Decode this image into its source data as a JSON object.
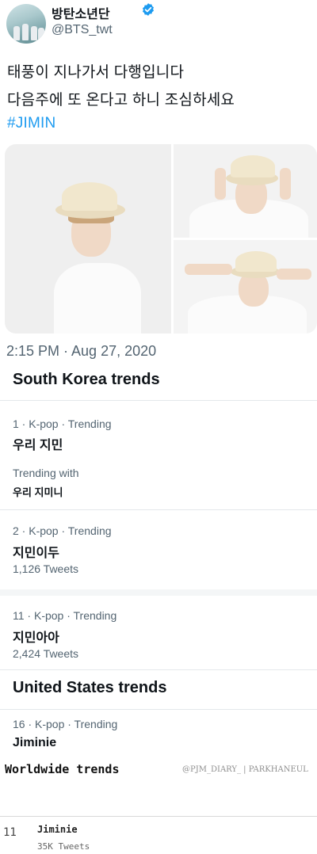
{
  "tweet": {
    "author_name": "방탄소년단",
    "author_handle": "@BTS_twt",
    "text_line1": "태풍이 지나가서 다행입니다",
    "text_line2": "다음주에 또 온다고 하니 조심하세요",
    "hashtag": "#JIMIN",
    "timestamp": "2:15 PM · Aug 27, 2020",
    "verified_icon": "verified-badge-icon",
    "accent_color": "#1d9bf0"
  },
  "south_korea": {
    "title": "South Korea trends",
    "trends": [
      {
        "meta": "1 · K-pop · Trending",
        "name": "우리 지민",
        "with_label": "Trending with",
        "with_value": "우리 지미니"
      },
      {
        "meta": "2 · K-pop · Trending",
        "name": "지민이두",
        "count": "1,126 Tweets"
      },
      {
        "meta": "11 · K-pop · Trending",
        "name": "지민아아",
        "count": "2,424 Tweets"
      }
    ]
  },
  "united_states": {
    "title": "United States trends",
    "trends": [
      {
        "meta": "16 · K-pop · Trending",
        "name": "Jiminie"
      }
    ]
  },
  "worldwide": {
    "title": "Worldwide trends",
    "watermark": "@PJM_DIARY_ | PARKHANEUL",
    "trends": [
      {
        "rank": "11",
        "name": "Jiminie",
        "count": "35K Tweets"
      }
    ]
  }
}
